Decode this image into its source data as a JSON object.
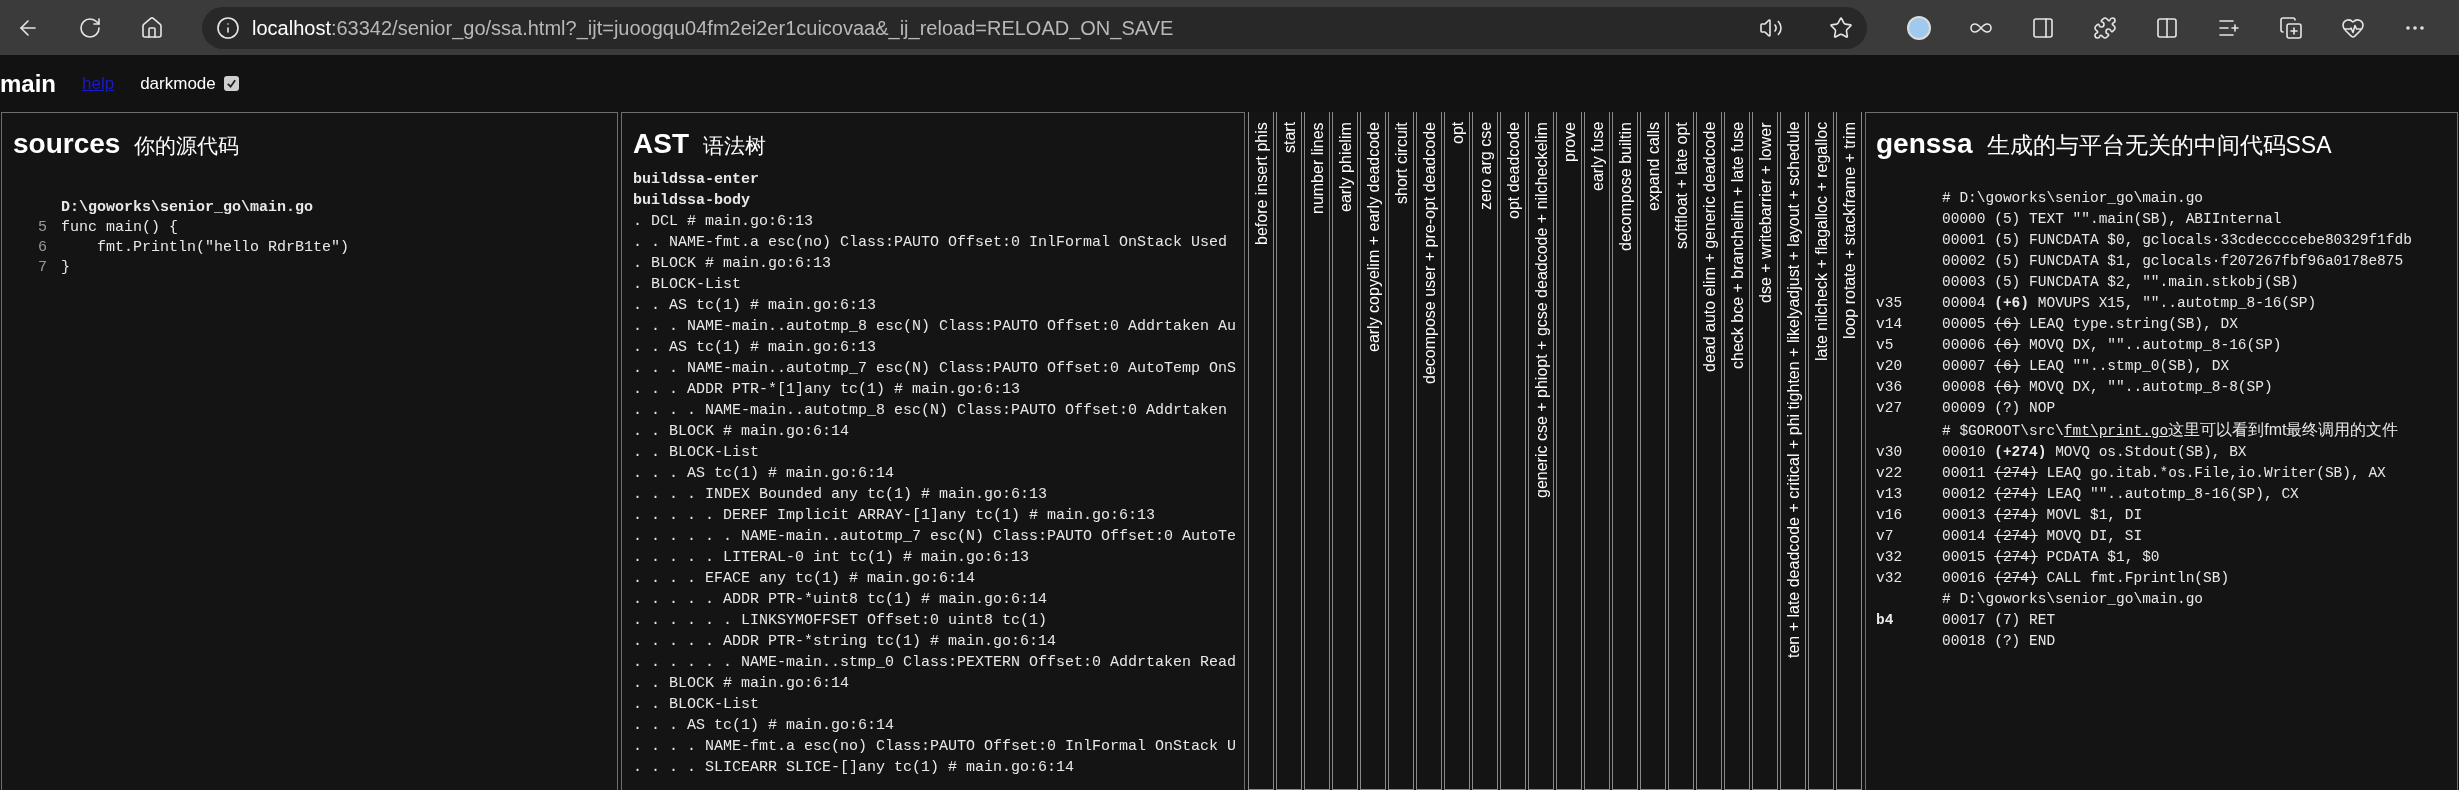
{
  "browser": {
    "url_host": "localhost",
    "url_rest": ":63342/senior_go/ssa.html?_ijt=juoogqu04fm2ei2er1cuicovaa&_ij_reload=RELOAD_ON_SAVE"
  },
  "page": {
    "title": "main",
    "help_link": "help",
    "darkmode": {
      "label": "darkmode",
      "checked": true
    }
  },
  "sources": {
    "title": "sources",
    "subtitle": "你的源代码",
    "file": "D:\\goworks\\senior_go\\main.go",
    "lines": [
      {
        "number": "5",
        "code": "func main() {"
      },
      {
        "number": "6",
        "code": "    fmt.Println(\"hello RdrB1te\")"
      },
      {
        "number": "7",
        "code": "}"
      }
    ]
  },
  "ast": {
    "title": "AST",
    "subtitle": "语法树",
    "lines": [
      {
        "text": "buildssa-enter",
        "bold": true
      },
      {
        "text": "buildssa-body",
        "bold": true
      },
      {
        "text": ". DCL # main.go:6:13",
        "bold": false
      },
      {
        "text": ". . NAME-fmt.a esc(no) Class:PAUTO Offset:0 InlFormal OnStack Used",
        "bold": false
      },
      {
        "text": ". BLOCK # main.go:6:13",
        "bold": false
      },
      {
        "text": ". BLOCK-List",
        "bold": false
      },
      {
        "text": ". . AS tc(1) # main.go:6:13",
        "bold": false
      },
      {
        "text": ". . . NAME-main..autotmp_8 esc(N) Class:PAUTO Offset:0 Addrtaken Au",
        "bold": false
      },
      {
        "text": ". . AS tc(1) # main.go:6:13",
        "bold": false
      },
      {
        "text": ". . . NAME-main..autotmp_7 esc(N) Class:PAUTO Offset:0 AutoTemp OnS",
        "bold": false
      },
      {
        "text": ". . . ADDR PTR-*[1]any tc(1) # main.go:6:13",
        "bold": false
      },
      {
        "text": ". . . . NAME-main..autotmp_8 esc(N) Class:PAUTO Offset:0 Addrtaken",
        "bold": false
      },
      {
        "text": ". . BLOCK # main.go:6:14",
        "bold": false
      },
      {
        "text": ". . BLOCK-List",
        "bold": false
      },
      {
        "text": ". . . AS tc(1) # main.go:6:14",
        "bold": false
      },
      {
        "text": ". . . . INDEX Bounded any tc(1) # main.go:6:13",
        "bold": false
      },
      {
        "text": ". . . . . DEREF Implicit ARRAY-[1]any tc(1) # main.go:6:13",
        "bold": false
      },
      {
        "text": ". . . . . . NAME-main..autotmp_7 esc(N) Class:PAUTO Offset:0 AutoTe",
        "bold": false
      },
      {
        "text": ". . . . . LITERAL-0 int tc(1) # main.go:6:13",
        "bold": false
      },
      {
        "text": ". . . . EFACE any tc(1) # main.go:6:14",
        "bold": false
      },
      {
        "text": ". . . . . ADDR PTR-*uint8 tc(1) # main.go:6:14",
        "bold": false
      },
      {
        "text": ". . . . . . LINKSYMOFFSET Offset:0 uint8 tc(1)",
        "bold": false
      },
      {
        "text": ". . . . . ADDR PTR-*string tc(1) # main.go:6:14",
        "bold": false
      },
      {
        "text": ". . . . . . NAME-main..stmp_0 Class:PEXTERN Offset:0 Addrtaken Read",
        "bold": false
      },
      {
        "text": ". . BLOCK # main.go:6:14",
        "bold": false
      },
      {
        "text": ". . BLOCK-List",
        "bold": false
      },
      {
        "text": ". . . AS tc(1) # main.go:6:14",
        "bold": false
      },
      {
        "text": ". . . . NAME-fmt.a esc(no) Class:PAUTO Offset:0 InlFormal OnStack U",
        "bold": false
      },
      {
        "text": ". . . . SLICEARR SLICE-[]any tc(1) # main.go:6:14",
        "bold": false
      }
    ]
  },
  "phases": [
    {
      "label": "before insert phis"
    },
    {
      "label": "start"
    },
    {
      "label": "number lines"
    },
    {
      "label": "early phielim"
    },
    {
      "label": "early copyelim + early deadcode"
    },
    {
      "label": "short circuit"
    },
    {
      "label": "decompose user + pre-opt deadcode"
    },
    {
      "label": "opt"
    },
    {
      "label": "zero arg cse"
    },
    {
      "label": "opt deadcode"
    },
    {
      "label": "generic cse + phiopt + gcse deadcode + nilcheckelim"
    },
    {
      "label": "prove"
    },
    {
      "label": "early fuse"
    },
    {
      "label": "decompose builtin"
    },
    {
      "label": "expand calls"
    },
    {
      "label": "softfloat + late opt"
    },
    {
      "label": "dead auto elim + generic deadcode"
    },
    {
      "label": "check bce + branchelim + late fuse"
    },
    {
      "label": "dse + writebarrier + lower"
    },
    {
      "label": "ten + late deadcode + critical + phi tighten + likelyadjust + layout + schedule"
    },
    {
      "label": "late nilcheck + flagalloc + regalloc"
    },
    {
      "label": "loop rotate + stackframe + trim"
    }
  ],
  "genssa": {
    "title": "genssa",
    "subtitle": "生成的与平台无关的中间代码SSA",
    "lines": [
      {
        "kind": "comment",
        "text": "# D:\\goworks\\senior_go\\main.go"
      },
      {
        "kind": "instr",
        "addr": "00000",
        "line": "(5)",
        "stmt": false,
        "struck": false,
        "op": "TEXT \"\".main(SB), ABIInternal"
      },
      {
        "kind": "instr",
        "addr": "00001",
        "line": "(5)",
        "stmt": false,
        "struck": false,
        "op": "FUNCDATA $0, gclocals·33cdeccccebe80329f1fdb"
      },
      {
        "kind": "instr",
        "addr": "00002",
        "line": "(5)",
        "stmt": false,
        "struck": false,
        "op": "FUNCDATA $1, gclocals·f207267fbf96a0178e875"
      },
      {
        "kind": "instr",
        "addr": "00003",
        "line": "(5)",
        "stmt": false,
        "struck": false,
        "op": "FUNCDATA $2, \"\".main.stkobj(SB)"
      },
      {
        "kind": "instr",
        "value": "v35",
        "bold": false,
        "addr": "00004",
        "line": "(+6)",
        "stmt": true,
        "struck": false,
        "op": "MOVUPS X15, \"\"..autotmp_8-16(SP)"
      },
      {
        "kind": "instr",
        "value": "v14",
        "bold": false,
        "addr": "00005",
        "line": "(6)",
        "stmt": false,
        "struck": true,
        "op": "LEAQ type.string(SB), DX"
      },
      {
        "kind": "instr",
        "value": "v5",
        "bold": false,
        "addr": "00006",
        "line": "(6)",
        "stmt": false,
        "struck": true,
        "op": "MOVQ DX, \"\"..autotmp_8-16(SP)"
      },
      {
        "kind": "instr",
        "value": "v20",
        "bold": false,
        "addr": "00007",
        "line": "(6)",
        "stmt": false,
        "struck": true,
        "op": "LEAQ \"\"..stmp_0(SB), DX"
      },
      {
        "kind": "instr",
        "value": "v36",
        "bold": false,
        "addr": "00008",
        "line": "(6)",
        "stmt": false,
        "struck": true,
        "op": "MOVQ DX, \"\"..autotmp_8-8(SP)"
      },
      {
        "kind": "instr",
        "value": "v27",
        "bold": false,
        "addr": "00009",
        "line": "(?)",
        "stmt": false,
        "struck": false,
        "op": "NOP"
      },
      {
        "kind": "comment",
        "text": "# $GOROOT\\src\\",
        "underlined": "fmt\\print.go",
        "note": "这里可以看到fmt最终调用的文件"
      },
      {
        "kind": "instr",
        "value": "v30",
        "bold": false,
        "addr": "00010",
        "line": "(+274)",
        "stmt": true,
        "struck": false,
        "op": "MOVQ os.Stdout(SB), BX"
      },
      {
        "kind": "instr",
        "value": "v22",
        "bold": false,
        "addr": "00011",
        "line": "(274)",
        "stmt": false,
        "struck": true,
        "op": "LEAQ go.itab.*os.File,io.Writer(SB), AX"
      },
      {
        "kind": "instr",
        "value": "v13",
        "bold": false,
        "addr": "00012",
        "line": "(274)",
        "stmt": false,
        "struck": true,
        "op": "LEAQ \"\"..autotmp_8-16(SP), CX"
      },
      {
        "kind": "instr",
        "value": "v16",
        "bold": false,
        "addr": "00013",
        "line": "(274)",
        "stmt": false,
        "struck": true,
        "op": "MOVL $1, DI"
      },
      {
        "kind": "instr",
        "value": "v7",
        "bold": false,
        "addr": "00014",
        "line": "(274)",
        "stmt": false,
        "struck": true,
        "op": "MOVQ DI, SI"
      },
      {
        "kind": "instr",
        "value": "v32",
        "bold": false,
        "addr": "00015",
        "line": "(274)",
        "stmt": false,
        "struck": true,
        "op": "PCDATA $1, $0"
      },
      {
        "kind": "instr",
        "value": "v32",
        "bold": false,
        "addr": "00016",
        "line": "(274)",
        "stmt": false,
        "struck": true,
        "op": "CALL fmt.Fprintln(SB)"
      },
      {
        "kind": "comment",
        "text": "# D:\\goworks\\senior_go\\main.go"
      },
      {
        "kind": "instr",
        "value": "b4",
        "bold": true,
        "addr": "00017",
        "line": "(7)",
        "stmt": false,
        "struck": false,
        "op": "RET"
      },
      {
        "kind": "instr",
        "addr": "00018",
        "line": "(?)",
        "stmt": false,
        "struck": false,
        "op": "END"
      }
    ]
  }
}
